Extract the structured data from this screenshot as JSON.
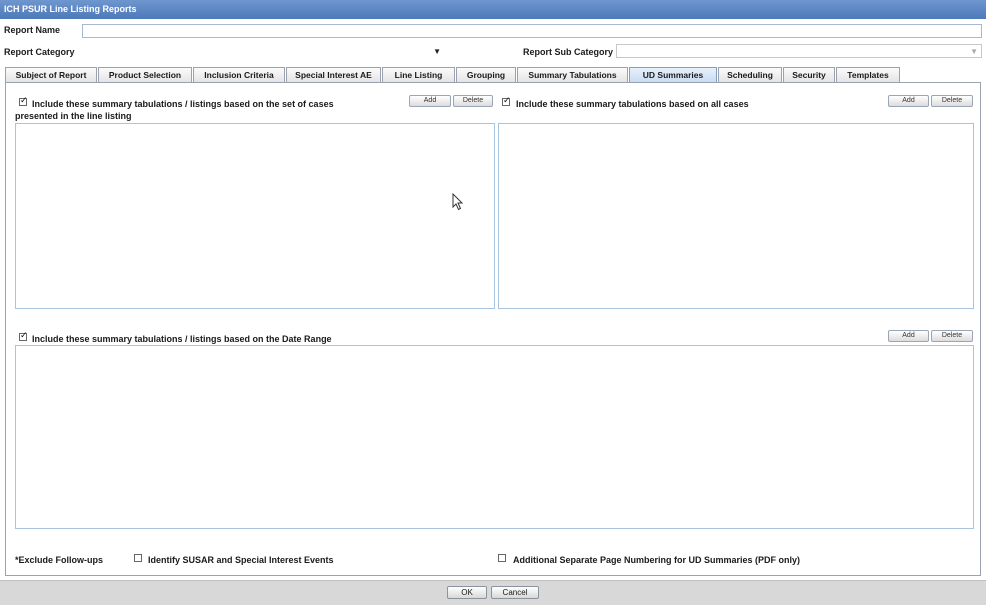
{
  "window": {
    "title": "ICH PSUR Line Listing Reports"
  },
  "form": {
    "report_name_label": "Report Name",
    "report_name_value": "",
    "report_category_label": "Report Category",
    "report_category_value": "",
    "report_sub_category_label": "Report Sub Category",
    "report_sub_category_value": ""
  },
  "tabs": [
    {
      "label": "Subject of Report",
      "active": false
    },
    {
      "label": "Product Selection",
      "active": false
    },
    {
      "label": "Inclusion Criteria",
      "active": false
    },
    {
      "label": "Special Interest AE",
      "active": false
    },
    {
      "label": "Line Listing",
      "active": false
    },
    {
      "label": "Grouping",
      "active": false
    },
    {
      "label": "Summary Tabulations",
      "active": false
    },
    {
      "label": "UD Summaries",
      "active": true
    },
    {
      "label": "Scheduling",
      "active": false
    },
    {
      "label": "Security",
      "active": false
    },
    {
      "label": "Templates",
      "active": false
    }
  ],
  "sections": {
    "line_listing": {
      "checked": true,
      "label_line1": "Include these summary tabulations / listings based on the set of cases",
      "label_line2": "presented in the line listing",
      "add": "Add",
      "delete": "Delete"
    },
    "all_cases": {
      "checked": true,
      "label": "Include these summary tabulations based on all cases",
      "add": "Add",
      "delete": "Delete"
    },
    "date_range": {
      "checked": true,
      "label": "Include these summary tabulations / listings based on the Date Range",
      "add": "Add",
      "delete": "Delete"
    }
  },
  "footer_options": {
    "exclude_followups": "*Exclude Follow-ups",
    "identify_susar": {
      "label": "Identify SUSAR and Special Interest Events",
      "checked": false
    },
    "separate_numbering": {
      "label": "Additional Separate Page Numbering for UD Summaries (PDF only)",
      "checked": false
    }
  },
  "dialog_buttons": {
    "ok": "OK",
    "cancel": "Cancel"
  },
  "icons": {
    "dropdown": "dropdown-arrow-icon",
    "cursor": "mouse-pointer-icon"
  },
  "colors": {
    "titlebar": "#5a85c2",
    "active_tab": "#c6daf2",
    "listbox_border": "#a9c4df"
  }
}
